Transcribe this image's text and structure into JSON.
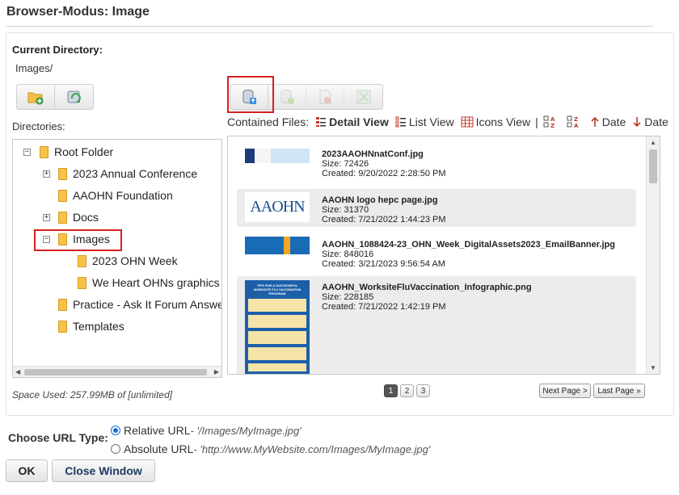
{
  "window": {
    "title": "Browser-Modus: Image"
  },
  "current_directory": {
    "label": "Current Directory:",
    "value": "Images/"
  },
  "toolbar_left": [
    {
      "icon": "new-folder-icon"
    },
    {
      "icon": "refresh-icon"
    }
  ],
  "toolbar_right": [
    {
      "icon": "upload-icon",
      "state": "enabled"
    },
    {
      "icon": "add-file-icon",
      "state": "disabled"
    },
    {
      "icon": "delete-file-icon",
      "state": "disabled"
    },
    {
      "icon": "resize-icon",
      "state": "disabled"
    }
  ],
  "directories": {
    "label": "Directories:",
    "tree": [
      {
        "label": "Root Folder",
        "toggle": "−"
      },
      {
        "label": "2023 Annual Conference",
        "toggle": "+"
      },
      {
        "label": "AAOHN Foundation",
        "toggle": ""
      },
      {
        "label": "Docs",
        "toggle": "+"
      },
      {
        "label": "Images",
        "toggle": "−",
        "selected": true
      },
      {
        "label": "2023 OHN Week",
        "toggle": ""
      },
      {
        "label": "We Heart OHNs graphics",
        "toggle": ""
      },
      {
        "label": "Practice - Ask It Forum Answers",
        "toggle": ""
      },
      {
        "label": "Templates",
        "toggle": ""
      }
    ]
  },
  "space_used": "Space Used: 257.99MB of [unlimited]",
  "contained_files": {
    "label": "Contained Files:",
    "views": [
      "Detail View",
      "List View",
      "Icons View"
    ],
    "separator": "|",
    "sort": [
      "Date",
      "Date"
    ]
  },
  "files": [
    {
      "name": "2023AAOHNnatConf.jpg",
      "size": "Size: 72426",
      "created": "Created: 9/20/2022 2:28:50 PM"
    },
    {
      "name": "AAOHN logo hepc page.jpg",
      "size": "Size: 31370",
      "created": "Created: 7/21/2022 1:44:23 PM"
    },
    {
      "name": "AAOHN_1088424-23_OHN_Week_DigitalAssets2023_EmailBanner.jpg",
      "size": "Size: 848016",
      "created": "Created: 3/21/2023 9:56:54 AM"
    },
    {
      "name": "AAOHN_WorksiteFluVaccination_Infographic.png",
      "size": "Size: 228185",
      "created": "Created: 7/21/2022 1:42:19 PM"
    }
  ],
  "thumbs": {
    "logo_text": "AAOHN",
    "infographic_title": "TIPS FOR A SUCCESSFUL WORKSITE FLU VACCINATION PROGRAM"
  },
  "pagination": {
    "pages": [
      "1",
      "2",
      "3"
    ],
    "current": "1",
    "next": "Next Page >",
    "last": "Last Page »"
  },
  "url_type": {
    "label": "Choose URL Type:",
    "relative": {
      "label": "Relative URL",
      "example": " - '/Images/MyImage.jpg'"
    },
    "absolute": {
      "label": "Absolute URL",
      "example": " - 'http://www.MyWebsite.com/Images/MyImage.jpg'"
    },
    "selected": "relative"
  },
  "buttons": {
    "ok": "OK",
    "close": "Close Window"
  },
  "colors": {
    "highlight": "#d42020",
    "folder": "#f7c24a",
    "radio": "#1a6fd6",
    "sort_arrow": "#c0392b"
  }
}
